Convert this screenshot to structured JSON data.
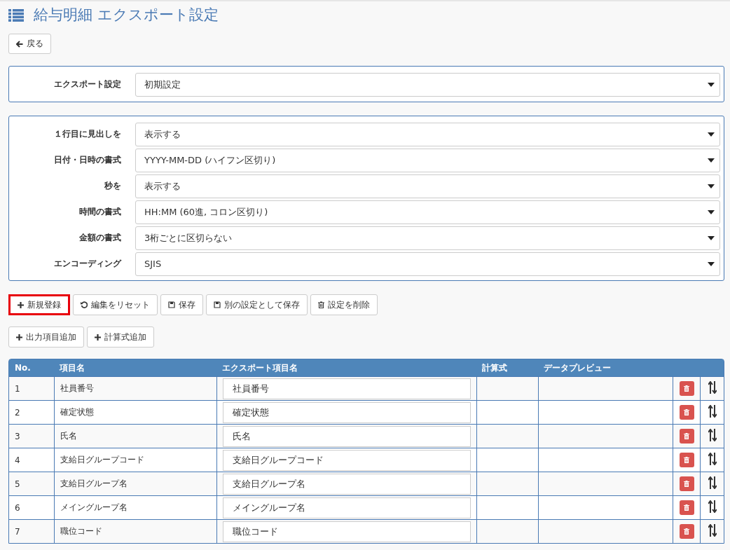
{
  "title": "給与明細 エクスポート設定",
  "back_button": "戻る",
  "export_setting": {
    "label": "エクスポート設定",
    "value": "初期設定"
  },
  "options": [
    {
      "label": "１行目に見出しを",
      "value": "表示する"
    },
    {
      "label": "日付・日時の書式",
      "value": "YYYY-MM-DD (ハイフン区切り)"
    },
    {
      "label": "秒を",
      "value": "表示する"
    },
    {
      "label": "時間の書式",
      "value": "HH:MM (60進, コロン区切り)"
    },
    {
      "label": "金額の書式",
      "value": "3桁ごとに区切らない"
    },
    {
      "label": "エンコーディング",
      "value": "SJIS"
    }
  ],
  "actions": [
    {
      "kind": "plus",
      "label": "新規登録",
      "highlighted": true
    },
    {
      "kind": "reset",
      "label": "編集をリセット",
      "highlighted": false
    },
    {
      "kind": "save",
      "label": "保存",
      "highlighted": false
    },
    {
      "kind": "save",
      "label": "別の設定として保存",
      "highlighted": false
    },
    {
      "kind": "trash",
      "label": "設定を削除",
      "highlighted": false
    }
  ],
  "add_buttons": [
    "出力項目追加",
    "計算式追加"
  ],
  "table": {
    "columns": [
      "No.",
      "項目名",
      "エクスポート項目名",
      "計算式",
      "データプレビュー"
    ],
    "rows": [
      {
        "no": "1",
        "name": "社員番号",
        "export_name": "社員番号"
      },
      {
        "no": "2",
        "name": "確定状態",
        "export_name": "確定状態"
      },
      {
        "no": "3",
        "name": "氏名",
        "export_name": "氏名"
      },
      {
        "no": "4",
        "name": "支給日グループコード",
        "export_name": "支給日グループコード"
      },
      {
        "no": "5",
        "name": "支給日グループ名",
        "export_name": "支給日グループ名"
      },
      {
        "no": "6",
        "name": "メイングループ名",
        "export_name": "メイングループ名"
      },
      {
        "no": "7",
        "name": "職位コード",
        "export_name": "職位コード"
      }
    ]
  }
}
